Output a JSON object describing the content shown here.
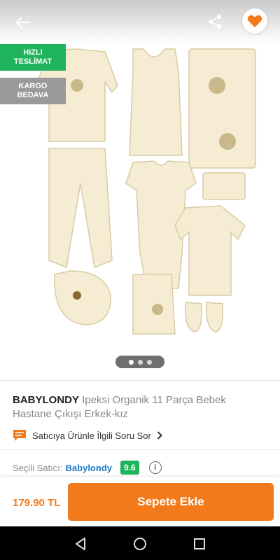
{
  "badges": {
    "fast_delivery": [
      "HIZLI",
      "TESLİMAT"
    ],
    "free_shipping": [
      "KARGO",
      "BEDAVA"
    ]
  },
  "product": {
    "brand": "BABYLONDY",
    "name": "Ipeksi Organik 11 Parça Bebek Hastane Çıkışı Erkek-kız"
  },
  "ask_seller": "Satıcıya Ürünle İlgili Soru Sor",
  "seller": {
    "label": "Seçili Satıcı:",
    "name": "Babylondy",
    "score": "9.6"
  },
  "footer": {
    "price": "179.90 TL",
    "cart_button": "Sepete Ekle"
  },
  "gallery": {
    "count": 3,
    "active": 1
  },
  "colors": {
    "accent": "#f27a1a",
    "green": "#1fb35b",
    "link": "#1e7ac7"
  },
  "icons": [
    "back-arrow-icon",
    "share-icon",
    "heart-icon",
    "chat-icon",
    "chevron-right-icon",
    "info-icon",
    "nav-back-icon",
    "nav-home-icon",
    "nav-recents-icon"
  ]
}
